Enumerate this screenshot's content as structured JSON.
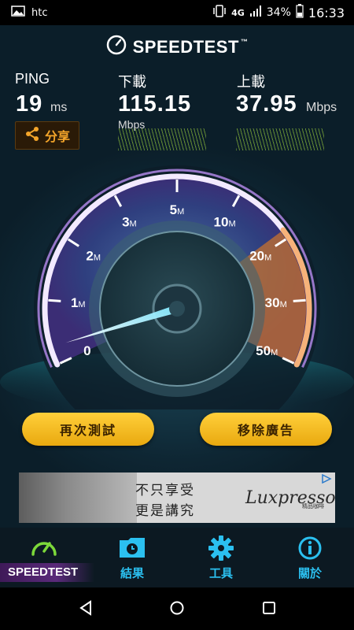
{
  "status_bar": {
    "carrier": "htc",
    "network": "4G",
    "battery": "34%",
    "time": "16:33",
    "icons": [
      "image-icon",
      "vibrate-icon",
      "signal-icon",
      "battery-icon"
    ]
  },
  "header": {
    "title": "SPEEDTEST",
    "trademark": "™"
  },
  "ping": {
    "label": "PING",
    "value": "19",
    "unit": "ms"
  },
  "download": {
    "label": "下載",
    "value": "115.15",
    "unit": "Mbps"
  },
  "upload": {
    "label": "上載",
    "value": "37.95",
    "unit": "Mbps"
  },
  "share": {
    "label": "分享"
  },
  "gauge": {
    "scale_labels": [
      {
        "num": "0",
        "unit": ""
      },
      {
        "num": "1",
        "unit": "M"
      },
      {
        "num": "2",
        "unit": "M"
      },
      {
        "num": "3",
        "unit": "M"
      },
      {
        "num": "5",
        "unit": "M"
      },
      {
        "num": "10",
        "unit": "M"
      },
      {
        "num": "20",
        "unit": "M"
      },
      {
        "num": "30",
        "unit": "M"
      },
      {
        "num": "50",
        "unit": "M"
      }
    ],
    "needle_value_mbps": 0
  },
  "buttons": {
    "retest": "再次測試",
    "remove_ads": "移除廣告"
  },
  "ad": {
    "line1": "不只享受",
    "line2": "更是講究",
    "brand": "Luxpresso",
    "brand_sub": "精品咖啡"
  },
  "tabs": [
    {
      "label": "SPEEDTEST",
      "active": true
    },
    {
      "label": "結果",
      "active": false
    },
    {
      "label": "工具",
      "active": false
    },
    {
      "label": "關於",
      "active": false
    }
  ],
  "colors": {
    "accent_orange": "#f4a52a",
    "tab_blue": "#2bc0f0",
    "gauge_purple": "#b98cf0",
    "button_yellow": "#f7be26"
  }
}
